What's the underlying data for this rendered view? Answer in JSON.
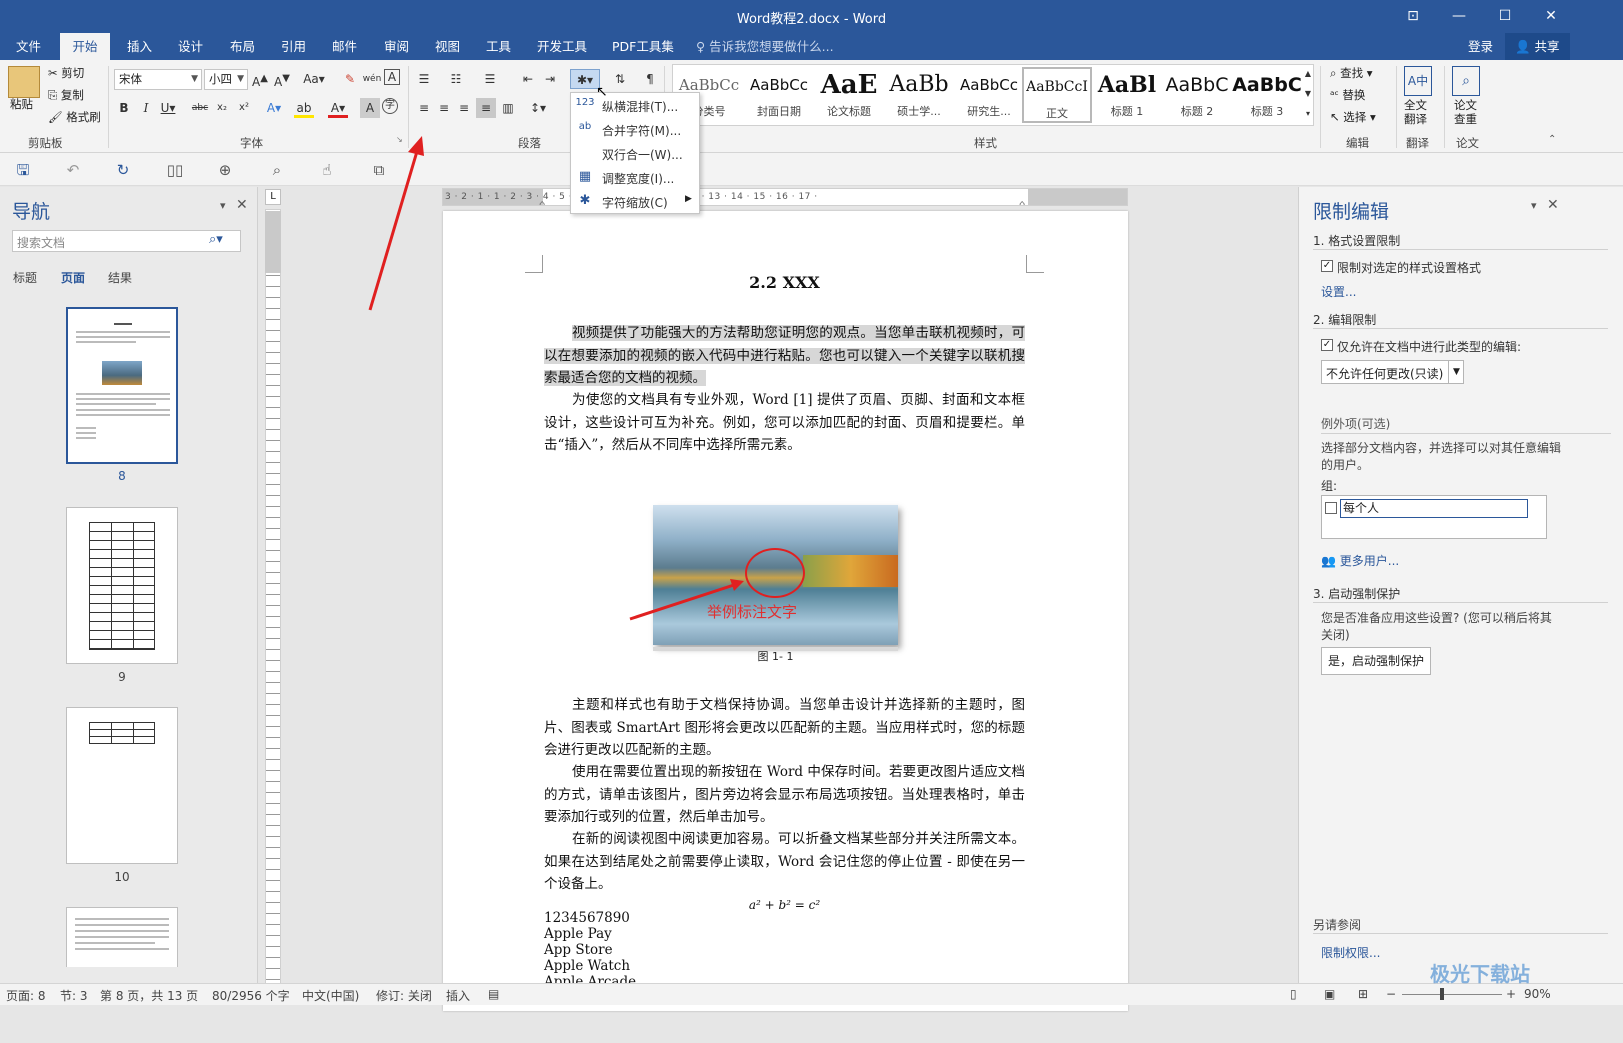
{
  "window": {
    "title": "Word教程2.docx - Word"
  },
  "tabs": [
    "文件",
    "开始",
    "插入",
    "设计",
    "布局",
    "引用",
    "邮件",
    "审阅",
    "视图",
    "工具",
    "开发工具",
    "PDF工具集"
  ],
  "tell_me": "告诉我您想要做什么...",
  "account": {
    "login": "登录",
    "share": "共享"
  },
  "ribbon": {
    "clipboard": {
      "paste": "粘贴",
      "cut": "剪切",
      "copy": "复制",
      "format_painter": "格式刷",
      "label": "剪贴板"
    },
    "font": {
      "name": "宋体",
      "size": "小四",
      "label": "字体"
    },
    "paragraph": {
      "label": "段落"
    },
    "styles": {
      "label": "样式",
      "items": [
        {
          "preview": "AaBbCc",
          "name": "分类号"
        },
        {
          "preview": "AaBbCc",
          "name": "封面日期"
        },
        {
          "preview": "AaE",
          "name": "论文标题"
        },
        {
          "preview": "AaBb",
          "name": "硕士学..."
        },
        {
          "preview": "AaBbCc",
          "name": "研究生..."
        },
        {
          "preview": "AaBbCcI",
          "name": "正文"
        },
        {
          "preview": "AaBl",
          "name": "标题 1"
        },
        {
          "preview": "AaBbC",
          "name": "标题 2"
        },
        {
          "preview": "AaBbC",
          "name": "标题 3"
        }
      ]
    },
    "editing": {
      "find": "查找",
      "replace": "替换",
      "select": "选择",
      "label": "编辑"
    },
    "translate": {
      "btn": "全文\n翻译",
      "label": "翻译"
    },
    "paper": {
      "btn": "论文\n查重",
      "label": "论文"
    }
  },
  "menu": {
    "items": [
      {
        "icon": "123",
        "label": "纵横混排(T)..."
      },
      {
        "icon": "ab",
        "label": "合并字符(M)..."
      },
      {
        "icon": "",
        "label": "双行合一(W)..."
      },
      {
        "icon": "▦",
        "label": "调整宽度(I)..."
      },
      {
        "icon": "✱",
        "label": "字符缩放(C)"
      }
    ]
  },
  "nav": {
    "title": "导航",
    "search_placeholder": "搜索文档",
    "tabs": [
      "标题",
      "页面",
      "结果"
    ],
    "pages": [
      "8",
      "9",
      "10"
    ]
  },
  "ruler": {
    "text": "3 · 2 · 1 · 1 · 2 · 3 · 4 · 5 · 6 · 7 · 8 · 9 · 10 · 11 · 12 · 13 · 14 · 15 · 16 · 17 ·"
  },
  "document": {
    "heading": "2.2 XXX",
    "p1": "视频提供了功能强大的方法帮助您证明您的观点。当您单击联机视频时，可以在想要添加的视频的嵌入代码中进行粘贴。您也可以键入一个关键字以联机搜索最适合您的文档的视频。",
    "p2": "为使您的文档具有专业外观，Word [1] 提供了页眉、页脚、封面和文本框设计，这些设计可互为补充。例如，您可以添加匹配的封面、页眉和提要栏。单击“插入”，然后从不同库中选择所需元素。",
    "figure_annotation": "举例标注文字",
    "caption": "图 1- 1",
    "p3": "主题和样式也有助于文档保持协调。当您单击设计并选择新的主题时，图片、图表或 SmartArt 图形将会更改以匹配新的主题。当应用样式时，您的标题会进行更改以匹配新的主题。",
    "p4": "使用在需要位置出现的新按钮在 Word 中保存时间。若要更改图片适应文档的方式，请单击该图片，图片旁边将会显示布局选项按钮。当处理表格时，单击要添加行或列的位置，然后单击加号。",
    "p5": "在新的阅读视图中阅读更加容易。可以折叠文档某些部分并关注所需文本。如果在达到结尾处之前需要停止读取，Word 会记住您的停止位置 - 即使在另一个设备上。",
    "equation": "a² + b² = c²",
    "lines": [
      "1234567890",
      "Apple Pay",
      "App Store",
      "Apple Watch",
      "Apple Arcade"
    ]
  },
  "restrict": {
    "title": "限制编辑",
    "s1": "1. 格式设置限制",
    "s1_check": "限制对选定的样式设置格式",
    "s1_link": "设置...",
    "s2": "2. 编辑限制",
    "s2_check": "仅允许在文档中进行此类型的编辑:",
    "s2_select": "不允许任何更改(只读)",
    "exceptions": "例外项(可选)",
    "exceptions_desc": "选择部分文档内容，并选择可以对其任意编辑的用户。",
    "group_label": "组:",
    "group_item": "每个人",
    "more_users": "更多用户...",
    "s3": "3. 启动强制保护",
    "s3_desc": "您是否准备应用这些设置? (您可以稍后将其关闭)",
    "s3_btn": "是，启动强制保护",
    "see_also": "另请参阅",
    "perm_link": "限制权限..."
  },
  "status": {
    "page": "页面: 8",
    "section": "节: 3",
    "pages": "第 8 页，共 13 页",
    "words": "80/2956 个字",
    "lang": "中文(中国)",
    "track": "修订: 关闭",
    "insert": "插入",
    "zoom": "90%"
  },
  "watermark": "极光下载站"
}
